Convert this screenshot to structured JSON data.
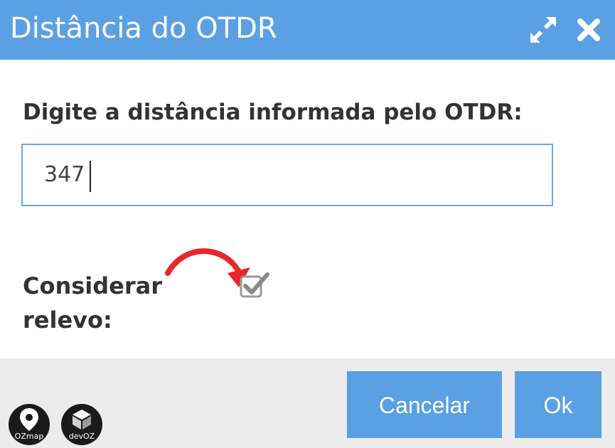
{
  "dialog": {
    "title": "Distância do OTDR",
    "controls": {
      "maximize_icon": "expand-arrows-icon",
      "close_icon": "close-icon"
    }
  },
  "form": {
    "distance_label": "Digite a distância informada pelo OTDR:",
    "distance_value": "347",
    "relief_label": "Considerar relevo:",
    "relief_checked": true
  },
  "footer": {
    "cancel_label": "Cancelar",
    "ok_label": "Ok"
  },
  "logos": {
    "ozmap": "OZmap",
    "devoz": "devOZ"
  },
  "colors": {
    "accent": "#5aa0e3",
    "annotation_arrow": "#e8262b",
    "footer_bg": "#ececec",
    "label_text": "#333333"
  }
}
